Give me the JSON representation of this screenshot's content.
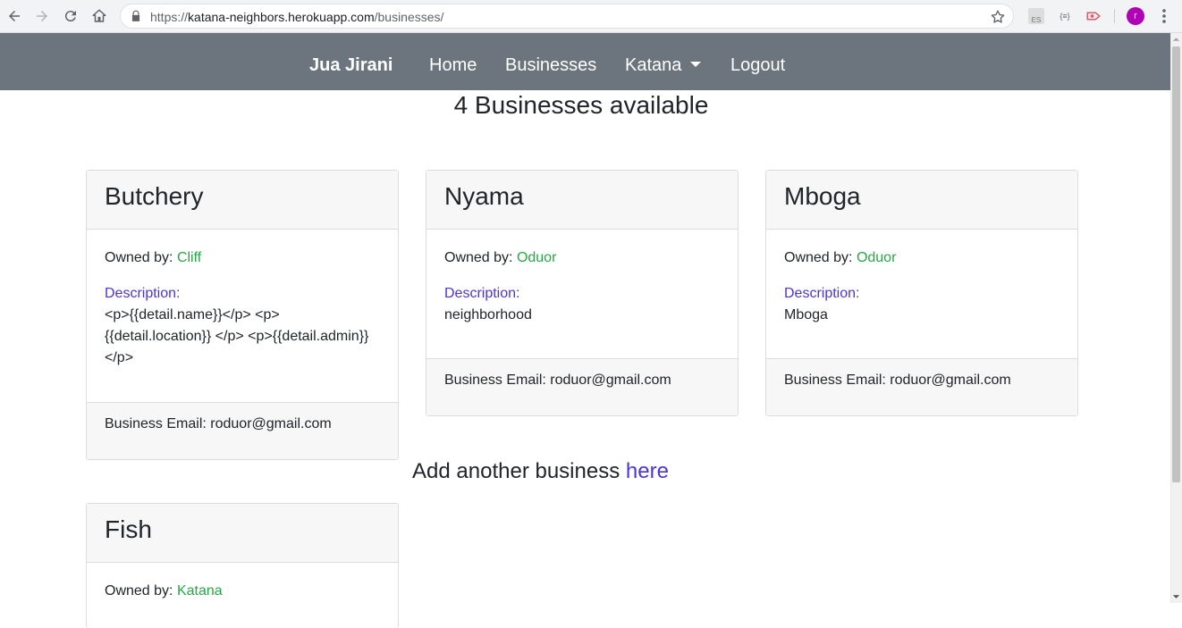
{
  "browser": {
    "url_scheme": "https://",
    "url_host": "katana-neighbors.herokuapp.com",
    "url_path": "/businesses/",
    "profile_initial": "r",
    "ext_es": "ES",
    "ext_json": "{≡}"
  },
  "navbar": {
    "brand": "Jua Jirani",
    "links": [
      "Home",
      "Businesses",
      "Katana",
      "Logout"
    ]
  },
  "page": {
    "heading": "4 Businesses available",
    "add_text": "Add another business",
    "add_link": "here"
  },
  "labels": {
    "owned_by": "Owned by:",
    "description": "Description:",
    "email_prefix": "Business Email:"
  },
  "businesses": [
    {
      "name": "Butchery",
      "owner": "Cliff",
      "description": "<p>{{detail.name}}</p> <p>{{detail.location}} </p> <p>{{detail.admin}}</p>",
      "email": "roduor@gmail.com"
    },
    {
      "name": "Nyama",
      "owner": "Oduor",
      "description": "neighborhood",
      "email": "roduor@gmail.com"
    },
    {
      "name": "Mboga",
      "owner": "Oduor",
      "description": "Mboga",
      "email": "roduor@gmail.com"
    },
    {
      "name": "Fish",
      "owner": "Katana"
    }
  ],
  "colors": {
    "navbar": "#6c757d",
    "owner": "#28a745",
    "link": "#4c35d6",
    "avatar": "#b000b5"
  }
}
